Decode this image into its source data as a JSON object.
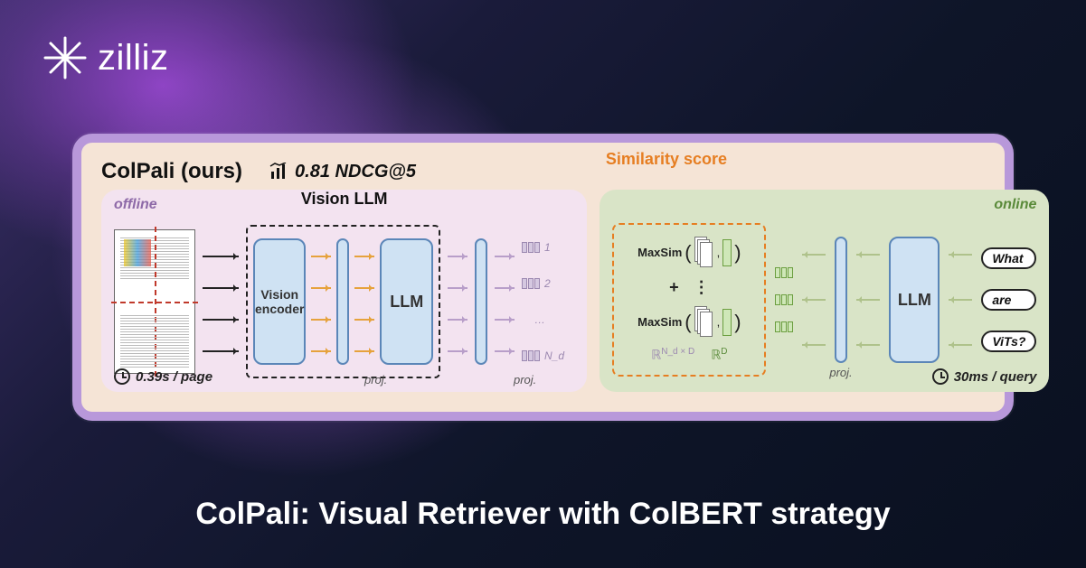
{
  "brand": {
    "name": "zilliz"
  },
  "diagram": {
    "title": "ColPali (ours)",
    "metric": "0.81 NDCG@5",
    "similarity_label": "Similarity score",
    "offline": {
      "tag": "offline",
      "vllm_label": "Vision LLM",
      "vision_encoder": "Vision encoder",
      "llm_block": "LLM",
      "proj": "proj.",
      "output_indices": [
        "1",
        "2",
        "…",
        "N_d"
      ],
      "timing": "0.39s / page"
    },
    "online": {
      "tag": "online",
      "maxsim": "MaxSim",
      "plus": "+",
      "r_doc": "ℝ",
      "doc_dim": "N_d × D",
      "query_dim": "D",
      "llm_block": "LLM",
      "proj": "proj.",
      "query_tokens": [
        "What",
        "are",
        "ViTs?"
      ],
      "timing": "30ms / query"
    }
  },
  "caption": "ColPali: Visual Retriever with ColBERT strategy"
}
